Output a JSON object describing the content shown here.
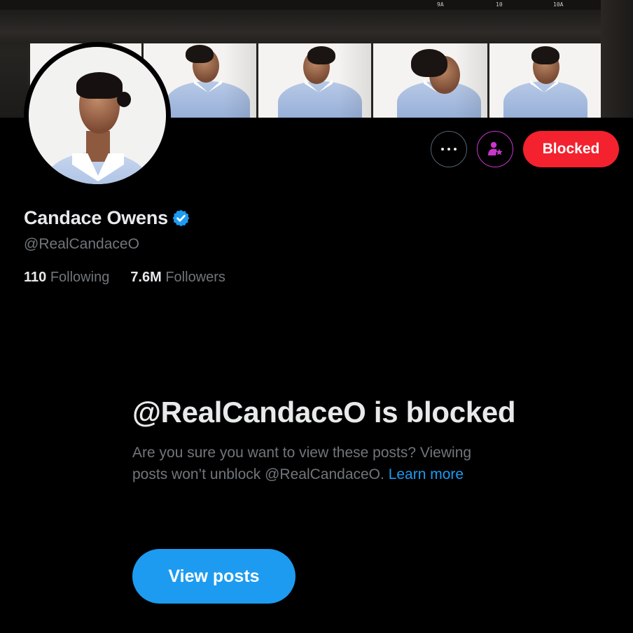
{
  "banner": {
    "frame_numbers": [
      "9A",
      "10",
      "10A"
    ]
  },
  "profile": {
    "display_name": "Candace Owens",
    "handle": "@RealCandaceO",
    "verified": true,
    "following_count": "110",
    "following_label": "Following",
    "followers_count": "7.6M",
    "followers_label": "Followers"
  },
  "actions": {
    "more_icon": "more-horizontal-icon",
    "subscribe_icon": "person-star-icon",
    "blocked_label": "Blocked"
  },
  "blocked_notice": {
    "title": "@RealCandaceO is blocked",
    "body": "Are you sure you want to view these posts? Viewing posts won’t unblock @RealCandaceO.",
    "learn_more": "Learn more",
    "view_posts_label": "View posts"
  },
  "colors": {
    "background": "#000000",
    "text_primary": "#e7e9ea",
    "text_secondary": "#71767b",
    "accent_blue": "#1d9bf0",
    "blocked_red": "#f4212e",
    "subscribe_purple": "#c936cc"
  }
}
